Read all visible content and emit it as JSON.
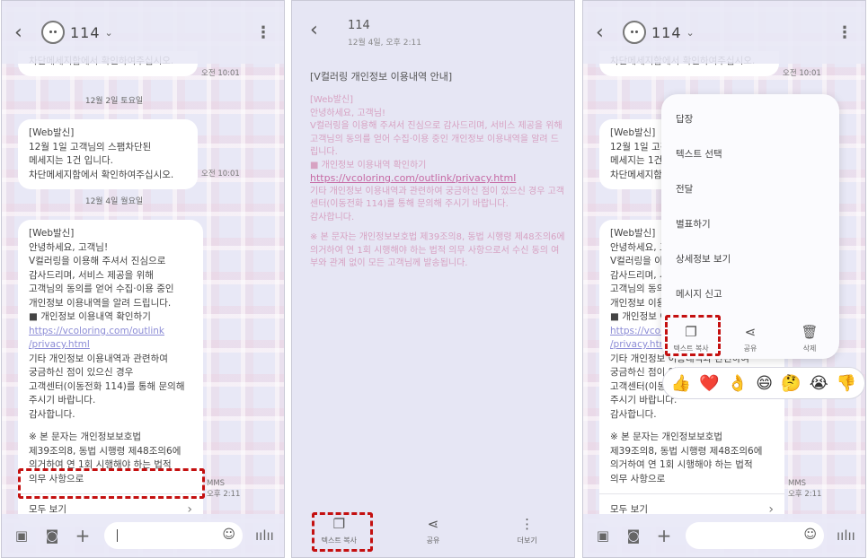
{
  "panel1": {
    "header": {
      "title": "114"
    },
    "msg0": {
      "line1": "차단메세지함에서 확인하여주십시오.",
      "time": "오전 10:01"
    },
    "date1": "12월 2일 토요일",
    "msg1": {
      "sender": "[Web발신]",
      "lines": [
        "12월 1일 고객님의 스팸차단된",
        "메세지는 1건 입니다.",
        "차단메세지함에서 확인하여주십시오."
      ],
      "time": "오전 10:01"
    },
    "date2": "12월 4일 월요일",
    "msg2": {
      "sender": "[Web발신]",
      "lines": [
        "안녕하세요, 고객님!",
        "V컬러링을 이용해 주셔서 진심으로",
        "감사드리며, 서비스 제공을 위해",
        "고객님의 동의를 얻어 수집·이용 중인",
        "개인정보 이용내역을 알려 드립니다.",
        "■ 개인정보 이용내역 확인하기"
      ],
      "link1": "https://vcoloring.com/outlink",
      "link2": "/privacy.html",
      "lines2": [
        "기타 개인정보 이용내역과 관련하여",
        "궁금하신 점이 있으신 경우",
        "고객센터(이동전화 114)를 통해 문의해",
        "주시기 바랍니다.",
        "감사합니다.",
        "",
        "※ 본 문자는 개인정보보호법",
        "제39조의8, 동법 시행령 제48조의6에",
        "의거하여 연 1회 시행해야 하는 법적",
        "의무 사항으로"
      ],
      "see_all": "모두 보기",
      "type": "MMS",
      "time": "오후 2:11"
    },
    "composer": {
      "placeholder": ""
    }
  },
  "panel2": {
    "title": "114",
    "time": "12월 4일, 오후 2:11",
    "heading": "[V컬러링 개인정보 이용내역 안내]",
    "sender": "[Web발신]",
    "lines": [
      "안녕하세요, 고객님!",
      "V컬러링을 이용해 주셔서 진심으로 감사드리며, 서비스 제공을 위해 고객님의 동의를 얻어 수집·이용 중인 개인정보 이용내역을 알려 드립니다.",
      "■ 개인정보 이용내역 확인하기"
    ],
    "link": "https://vcoloring.com/outlink/privacy.html",
    "lines2": "기타 개인정보 이용내역과 관련하여 궁금하신 점이 있으신 경우 고객센터(이동전화 114)를 통해 문의해 주시기 바랍니다.",
    "thanks": "감사합니다.",
    "notice": "※ 본 문자는 개인정보보호법 제39조의8, 동법 시행령 제48조의6에 의거하여 연 1회 시행해야 하는 법적 의무 사항으로서 수신 동의 여부와 관계 없이 모든 고객님께 발송됩니다.",
    "actions": {
      "copy": "텍스트 복사",
      "share": "공유",
      "more": "더보기"
    }
  },
  "panel3": {
    "menu": [
      "답장",
      "텍스트 선택",
      "전달",
      "별표하기",
      "상세정보 보기",
      "메시지 신고"
    ],
    "actions": {
      "copy": "텍스트 복사",
      "share": "공유",
      "delete": "삭제"
    },
    "reactions": [
      "👍",
      "❤️",
      "👌",
      "😄",
      "🤔",
      "😭",
      "👎"
    ]
  },
  "colors": {
    "highlight": "#c41010",
    "link": "#8c8cd6",
    "pink_text": "#d7a2c2"
  }
}
